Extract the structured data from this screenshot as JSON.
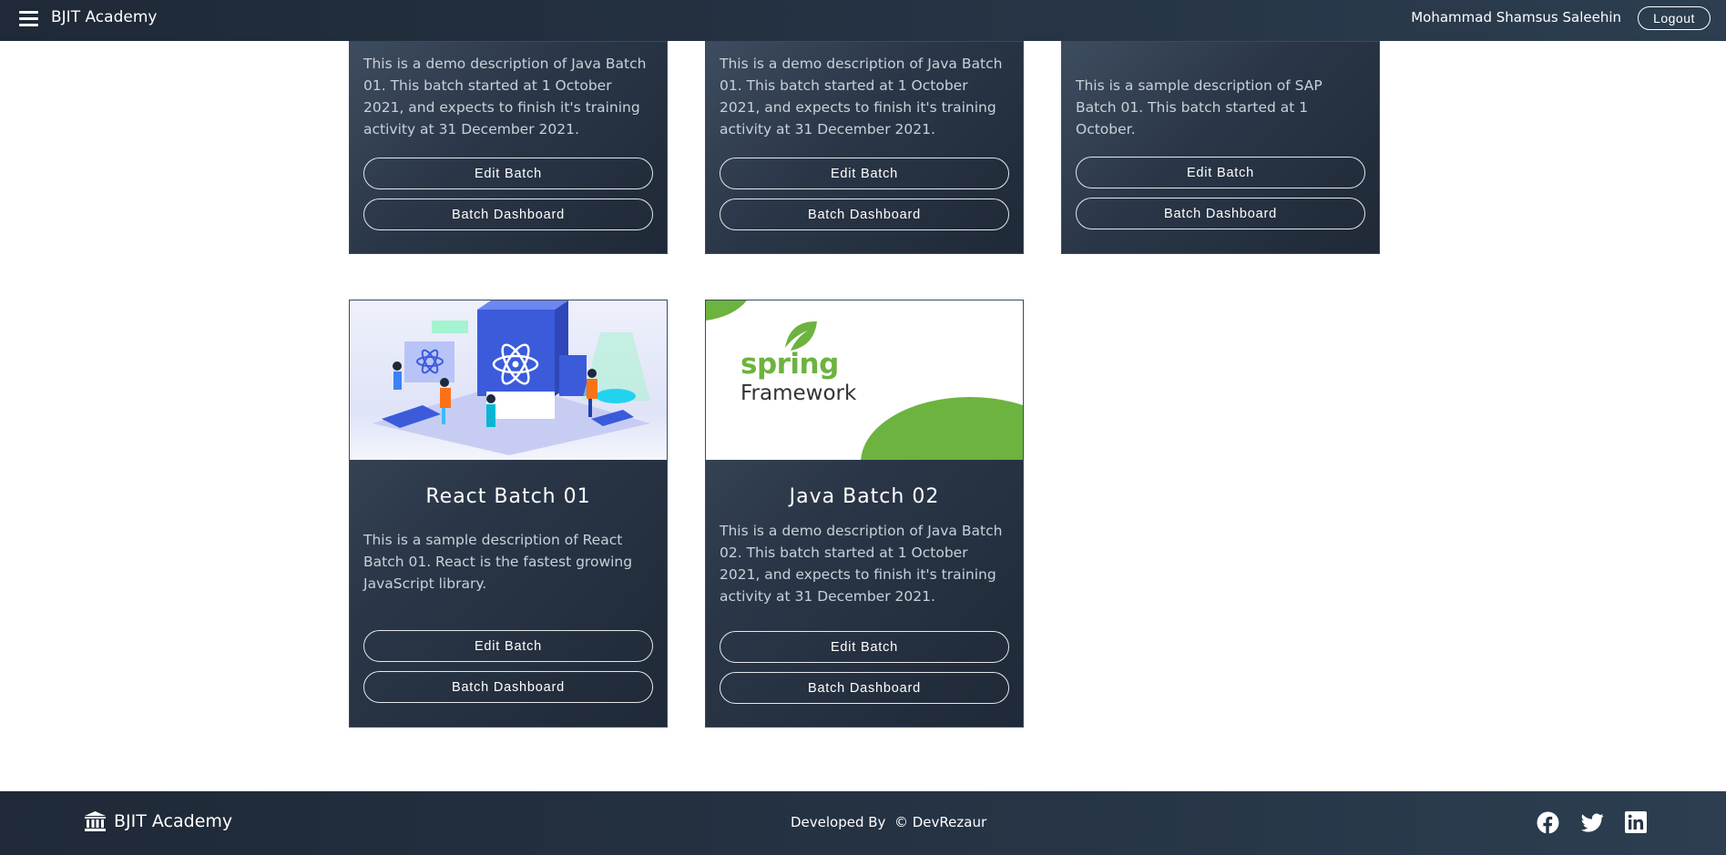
{
  "navbar": {
    "brand": "BJIT Academy",
    "user_name": "Mohammad Shamsus Saleehin",
    "logout_label": "Logout"
  },
  "cards": [
    {
      "description": "This is a demo description of Java Batch 01. This batch started at 1 October 2021, and expects to finish it's training activity at 31 December 2021.",
      "edit_label": "Edit Batch",
      "dashboard_label": "Batch Dashboard"
    },
    {
      "description": "This is a demo description of Java Batch 01. This batch started at 1 October 2021, and expects to finish it's training activity at 31 December 2021.",
      "edit_label": "Edit Batch",
      "dashboard_label": "Batch Dashboard"
    },
    {
      "description": "This is a sample description of SAP Batch 01. This batch started at 1 October.",
      "edit_label": "Edit Batch",
      "dashboard_label": "Batch Dashboard"
    },
    {
      "title": "React Batch 01",
      "description": "This is a sample description of React Batch 01. React is the fastest growing JavaScript library.",
      "edit_label": "Edit Batch",
      "dashboard_label": "Batch Dashboard",
      "image": "react-illustration"
    },
    {
      "title": "Java Batch 02",
      "description": "This is a demo description of Java Batch 02. This batch started at 1 October 2021, and expects to finish it's training activity at 31 December 2021.",
      "edit_label": "Edit Batch",
      "dashboard_label": "Batch Dashboard",
      "image": "spring-framework-logo",
      "image_text_line1": "spring",
      "image_text_line2": "Framework"
    }
  ],
  "footer": {
    "brand": "BJIT Academy",
    "credit": "Developed By  © DevRezaur",
    "social_icons": [
      "facebook-icon",
      "twitter-icon",
      "linkedin-icon"
    ]
  },
  "colors": {
    "navbar_bg": "#1f2937",
    "card_bg": "#2a3647",
    "card_text": "#c9d0d8",
    "spring_green": "#6db33f",
    "react_blue": "#3b5bdb"
  }
}
